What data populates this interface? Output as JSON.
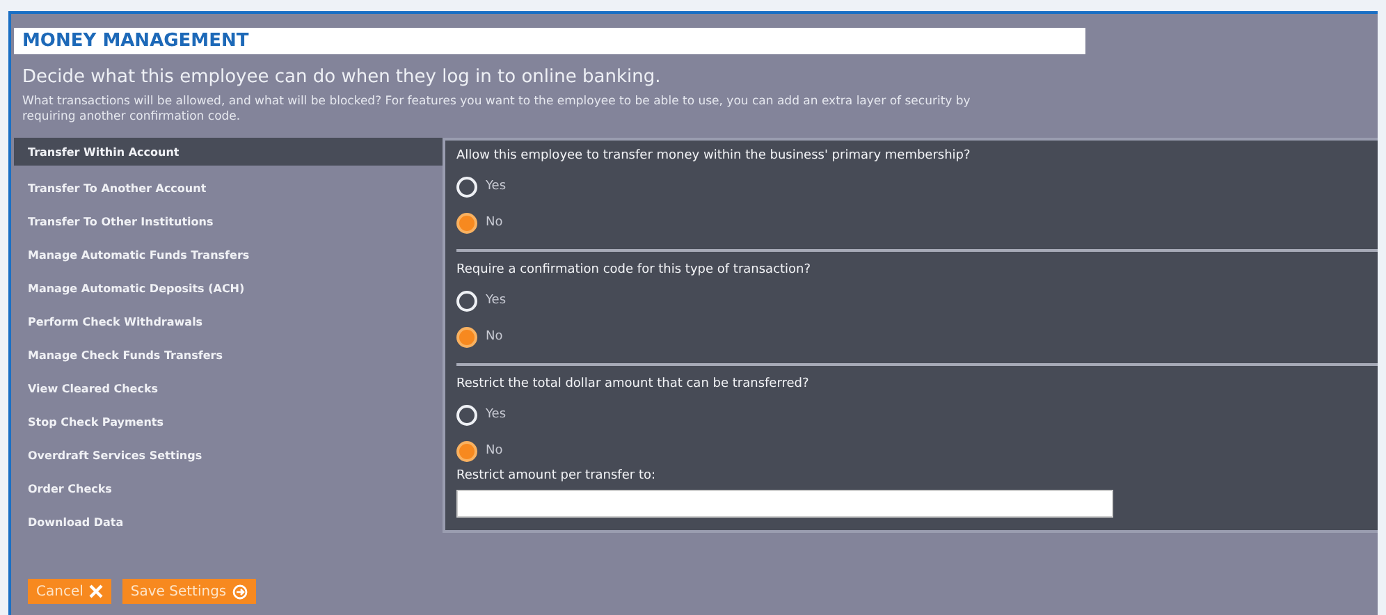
{
  "section_title": "MONEY MANAGEMENT",
  "heading": "Decide what this employee can do when they log in to online banking.",
  "description": "What transactions will be allowed, and what will be blocked? For features you want to the employee to be able to use, you can add an extra layer of security by requiring another confirmation code.",
  "sidebar": {
    "items": [
      {
        "label": "Transfer Within Account",
        "selected": true
      },
      {
        "label": "Transfer To Another Account",
        "selected": false
      },
      {
        "label": "Transfer To Other Institutions",
        "selected": false
      },
      {
        "label": "Manage Automatic Funds Transfers",
        "selected": false
      },
      {
        "label": "Manage Automatic Deposits (ACH)",
        "selected": false
      },
      {
        "label": "Perform Check Withdrawals",
        "selected": false
      },
      {
        "label": "Manage Check Funds Transfers",
        "selected": false
      },
      {
        "label": "View Cleared Checks",
        "selected": false
      },
      {
        "label": "Stop Check Payments",
        "selected": false
      },
      {
        "label": "Overdraft Services Settings",
        "selected": false
      },
      {
        "label": "Order Checks",
        "selected": false
      },
      {
        "label": "Download Data",
        "selected": false
      }
    ]
  },
  "questions": [
    {
      "text": "Allow this employee to transfer money within the business' primary membership?",
      "options": [
        {
          "label": "Yes",
          "selected": false
        },
        {
          "label": "No",
          "selected": true
        }
      ]
    },
    {
      "text": "Require a confirmation code for this type of transaction?",
      "options": [
        {
          "label": "Yes",
          "selected": false
        },
        {
          "label": "No",
          "selected": true
        }
      ]
    },
    {
      "text": "Restrict the total dollar amount that can be transferred?",
      "options": [
        {
          "label": "Yes",
          "selected": false
        },
        {
          "label": "No",
          "selected": true
        }
      ]
    }
  ],
  "amount_field": {
    "label": "Restrict amount per transfer to:"
  },
  "buttons": [
    {
      "label": "Cancel",
      "kind": "cancel"
    },
    {
      "label": "Save Settings",
      "kind": "save"
    }
  ]
}
